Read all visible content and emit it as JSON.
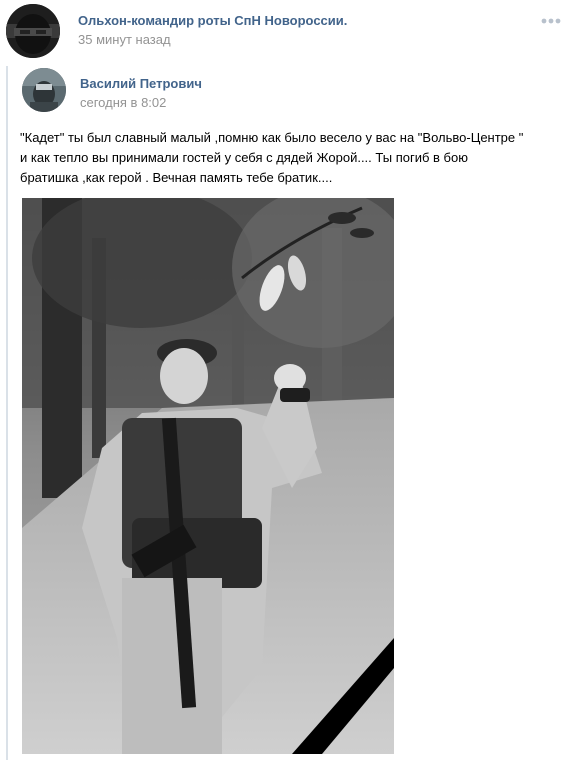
{
  "post": {
    "author": "Ольхон-командир роты СпН Новороссии.",
    "time": "35 минут назад",
    "more_icon": "more-dots-icon"
  },
  "repost": {
    "author": "Василий Петрович",
    "time": "сегодня в 8:02",
    "text_lines": [
      "\"Кадет\" ты был славный малый ,помню как было весело у вас на \"Вольво-Центре \"",
      "и как тепло вы принимали гостей у себя с дядей Жорой.... Ты погиб в бою",
      "братишка ,как герой . Вечная память тебе братик...."
    ],
    "photo": {
      "kind": "black-and-white memorial photo with black mourning ribbon"
    }
  },
  "colors": {
    "link": "#42648b",
    "meta": "#939393",
    "repost_border": "#dae1e8"
  }
}
